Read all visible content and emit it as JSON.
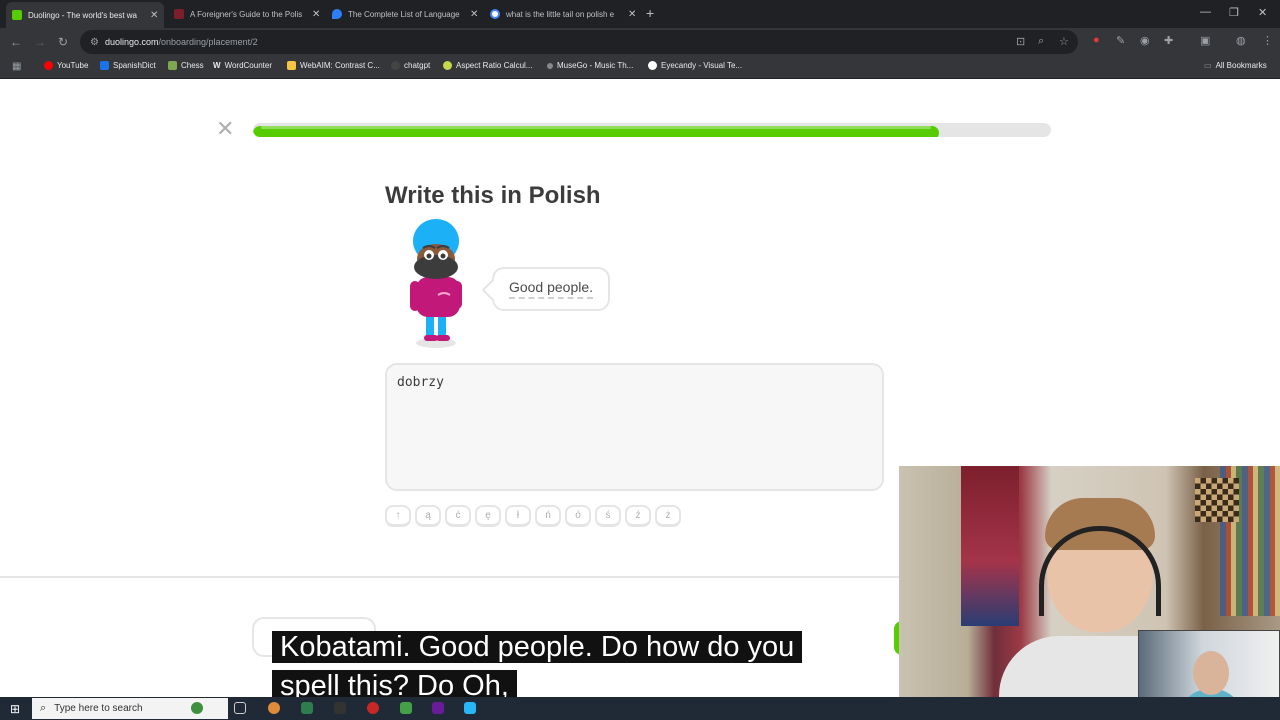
{
  "browser": {
    "tabs": [
      {
        "title": "Duolingo - The world's best wa",
        "favicon_color": "#58cc02",
        "active": true
      },
      {
        "title": "A Foreigner's Guide to the Polis",
        "favicon_color": "#7a1f2b",
        "active": false
      },
      {
        "title": "The Complete List of Language",
        "favicon_color": "#2d7ff9",
        "active": false
      },
      {
        "title": "what is the little tail on polish e",
        "favicon_color": "#4285f4",
        "active": false
      }
    ],
    "new_tab": "+",
    "url_host": "duolingo.com",
    "url_path": "/onboarding/placement/2",
    "bookmarks": [
      {
        "label": "YouTube",
        "color": "#ff0000"
      },
      {
        "label": "SpanishDict",
        "color": "#1a73e8"
      },
      {
        "label": "Chess",
        "color": "#7fa650"
      },
      {
        "label": "WordCounter",
        "color": "#ffffff"
      },
      {
        "label": "WebAIM: Contrast C...",
        "color": "#f6c343"
      },
      {
        "label": "chatgpt",
        "color": "#222222"
      },
      {
        "label": "Aspect Ratio Calcul...",
        "color": "#c6d84a"
      },
      {
        "label": "MuseGo - Music Th...",
        "color": "#888888"
      },
      {
        "label": "Eyecandy - Visual Te...",
        "color": "#ffffff"
      }
    ],
    "all_bookmarks": "All Bookmarks"
  },
  "lesson": {
    "close": "✕",
    "progress": 0.86,
    "heading": "Write this in Polish",
    "prompt": "Good people.",
    "answer": "dobrzy",
    "special_keys": [
      "↑",
      "ą",
      "ć",
      "ę",
      "ł",
      "ń",
      "ó",
      "ś",
      "ź",
      "ż"
    ],
    "skip_label": "Skip"
  },
  "caption": {
    "line1": "Kobatami. Good people. Do how do you",
    "line2": "spell this? Do Oh,"
  },
  "taskbar": {
    "search_placeholder": "Type here to search"
  },
  "colors": {
    "progress_fill": "#58cc02",
    "character_skin": "#8a5a3b",
    "character_turban": "#1cb0f6",
    "character_shirt": "#c1187a"
  }
}
